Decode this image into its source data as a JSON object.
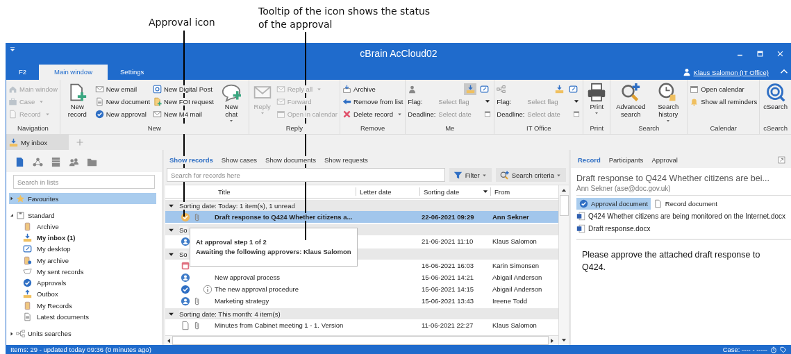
{
  "annotations": [
    {
      "text": "Approval icon"
    },
    {
      "text": "Tooltip of the icon shows the status of the approval"
    }
  ],
  "window": {
    "title": "cBrain AcCloud02"
  },
  "menu_tabs": [
    {
      "label": "F2",
      "selected": false
    },
    {
      "label": "Main window",
      "selected": true
    },
    {
      "label": "Settings",
      "selected": false
    }
  ],
  "user": "Klaus Salomon (IT Office)",
  "ribbon": [
    {
      "label": "Navigation",
      "items": [
        {
          "kind": "small",
          "label": "Main window",
          "disabled": true,
          "dropdown": false
        },
        {
          "kind": "small",
          "label": "Case",
          "disabled": true,
          "dropdown": true
        },
        {
          "kind": "small",
          "label": "Record",
          "disabled": true,
          "dropdown": true
        }
      ]
    },
    {
      "label": "New",
      "items": [
        {
          "kind": "large",
          "label": "New record",
          "disabled": false,
          "dropdown": false
        },
        {
          "kind": "small",
          "label": "New email",
          "disabled": false,
          "dropdown": false
        },
        {
          "kind": "small",
          "label": "New document",
          "disabled": false,
          "dropdown": false
        },
        {
          "kind": "small",
          "label": "New approval",
          "disabled": false,
          "dropdown": false
        },
        {
          "kind": "small",
          "label": "New Digital Post",
          "disabled": false,
          "dropdown": false
        },
        {
          "kind": "small",
          "label": "New FOI request",
          "disabled": false,
          "dropdown": false
        },
        {
          "kind": "small",
          "label": "New M4 mail",
          "disabled": false,
          "dropdown": false
        },
        {
          "kind": "large",
          "label": "New chat",
          "disabled": false,
          "dropdown": true
        }
      ]
    },
    {
      "label": "Reply",
      "items": [
        {
          "kind": "large",
          "label": "Reply",
          "disabled": true,
          "dropdown": true
        },
        {
          "kind": "small",
          "label": "Reply all",
          "disabled": true,
          "dropdown": true
        },
        {
          "kind": "small",
          "label": "Forward",
          "disabled": true,
          "dropdown": false
        },
        {
          "kind": "small",
          "label": "Open in calendar",
          "disabled": true,
          "dropdown": false
        }
      ]
    },
    {
      "label": "Remove",
      "items": [
        {
          "kind": "small",
          "label": "Archive",
          "disabled": false,
          "dropdown": false
        },
        {
          "kind": "small",
          "label": "Remove from list",
          "disabled": false,
          "dropdown": false
        },
        {
          "kind": "small",
          "label": "Delete record",
          "disabled": false,
          "dropdown": true
        }
      ]
    },
    {
      "label": "Me",
      "items": [
        {
          "kind": "icon_row",
          "toggles": [
            {
              "selected": true
            },
            {
              "selected": false
            }
          ]
        },
        {
          "kind": "dropdown_field",
          "label": "Flag:",
          "placeholder": "Select flag"
        },
        {
          "kind": "date_field",
          "label": "Deadline:",
          "placeholder": "Select date"
        }
      ]
    },
    {
      "label": "IT Office",
      "items": [
        {
          "kind": "icon_row",
          "toggles": [
            {
              "selected": false
            },
            {
              "selected": false
            }
          ]
        },
        {
          "kind": "dropdown_field",
          "label": "Flag:",
          "placeholder": "Select flag"
        },
        {
          "kind": "date_field",
          "label": "Deadline:",
          "placeholder": "Select date"
        }
      ]
    },
    {
      "label": "Print",
      "items": [
        {
          "kind": "large",
          "label": "Print",
          "disabled": false,
          "dropdown": true
        }
      ]
    },
    {
      "label": "Search",
      "items": [
        {
          "kind": "large",
          "label": "Advanced search",
          "disabled": false,
          "dropdown": false
        },
        {
          "kind": "large",
          "label": "Search history",
          "disabled": false,
          "dropdown": true
        }
      ]
    },
    {
      "label": "Calendar",
      "items": [
        {
          "kind": "small",
          "label": "Open calendar",
          "disabled": false,
          "dropdown": false
        },
        {
          "kind": "small",
          "label": "Show all reminders",
          "disabled": false,
          "dropdown": false
        }
      ]
    },
    {
      "label": "cSearch",
      "items": [
        {
          "kind": "large",
          "label": "cSearch",
          "disabled": false,
          "dropdown": false
        }
      ]
    }
  ],
  "doc_tabs": [
    {
      "label": "My inbox",
      "selected": true
    }
  ],
  "lists_toolbar": [
    {
      "selected": true
    },
    {
      "selected": false
    },
    {
      "selected": false
    },
    {
      "selected": false
    },
    {
      "selected": false
    }
  ],
  "lists_search": {
    "placeholder": "Search in lists"
  },
  "tree": [
    {
      "label": "Favourites",
      "expanded": false,
      "selected": true
    },
    {
      "label": "Standard",
      "expanded": true,
      "selected": false,
      "children": [
        {
          "label": "Archive",
          "unread": false,
          "selected": false
        },
        {
          "label": "My inbox (1)",
          "unread": true,
          "selected": false
        },
        {
          "label": "My desktop",
          "unread": false,
          "selected": false
        },
        {
          "label": "My archive",
          "unread": false,
          "selected": false
        },
        {
          "label": "My sent records",
          "unread": false,
          "selected": false
        },
        {
          "label": "Approvals",
          "unread": false,
          "selected": false
        },
        {
          "label": "Outbox",
          "unread": false,
          "selected": false
        },
        {
          "label": "My Records",
          "unread": false,
          "selected": false
        },
        {
          "label": "Latest documents",
          "unread": false,
          "selected": false
        }
      ]
    },
    {
      "label": "Units searches",
      "expanded": false,
      "selected": false
    }
  ],
  "view_tabs": [
    {
      "label": "Show records",
      "selected": true
    },
    {
      "label": "Show cases",
      "selected": false
    },
    {
      "label": "Show documents",
      "selected": false
    },
    {
      "label": "Show requests",
      "selected": false
    }
  ],
  "records_search": {
    "placeholder": "Search for records here"
  },
  "filter_button": "Filter",
  "criteria_button": "Search criteria",
  "columns": [
    {
      "label": "Title",
      "sorted": false
    },
    {
      "label": "Letter date",
      "sorted": false
    },
    {
      "label": "Sorting date",
      "sorted": true
    },
    {
      "label": "From",
      "sorted": false
    }
  ],
  "groups": [
    {
      "label": "Sorting date: Today: 1 item(s), 1 unread",
      "records": [
        {
          "kind": "approval_pending",
          "attachment": true,
          "title": "Draft response to Q424 Whether citizens a...",
          "sorting_date": "22-06-2021 09:29",
          "from": "Ann Sekner",
          "selected": true,
          "unread": true
        }
      ]
    },
    {
      "label": "So",
      "records": [
        {
          "kind": "approval_person",
          "sorting_date": "21-06-2021 11:10",
          "from": "Klaus Salomon",
          "selected": false,
          "unread": false
        }
      ]
    },
    {
      "label": "So",
      "records": [
        {
          "kind": "calendar",
          "sorting_date": "16-06-2021 16:03",
          "from": "Karin Simonsen",
          "selected": false,
          "unread": false
        },
        {
          "kind": "approval_person",
          "title": "New approval process",
          "sorting_date": "15-06-2021 14:21",
          "from": "Abigail Anderson",
          "selected": false,
          "unread": false
        },
        {
          "kind": "approval_done",
          "info": true,
          "title": "The new approval procedure",
          "sorting_date": "15-06-2021 14:15",
          "from": "Abigail Anderson",
          "selected": false,
          "unread": false
        },
        {
          "kind": "approval_person",
          "attachment": true,
          "title": "Marketing strategy",
          "sorting_date": "15-06-2021 13:43",
          "from": "Ireene Todd",
          "selected": false,
          "unread": false
        }
      ]
    },
    {
      "label": "Sorting date: This month: 4 item(s)",
      "records": [
        {
          "kind": "document",
          "attachment": true,
          "title": "Minutes from Cabinet meeting 1 - 1. Version",
          "sorting_date": "11-06-2021 22:27",
          "from": "Klaus Salomon",
          "selected": false,
          "unread": false
        }
      ]
    }
  ],
  "tooltip": {
    "lines": [
      "At approval step 1 of 2",
      "Awaiting the following approvers: Klaus Salomon"
    ]
  },
  "detail": {
    "tabs": [
      {
        "label": "Record",
        "selected": true
      },
      {
        "label": "Participants",
        "selected": false
      },
      {
        "label": "Approval",
        "selected": false
      }
    ],
    "title": "Draft response to Q424 Whether citizens are bei...",
    "sender": "Ann Sekner (ase@doc.gov.uk)",
    "doc_tabs": [
      {
        "label": "Approval document",
        "selected": true
      },
      {
        "label": "Record document",
        "selected": false
      }
    ],
    "attachments": [
      "Q424 Whether citizens are being monitored on the Internet.docx",
      "Draft response.docx"
    ],
    "body": "Please approve the attached draft response to Q424."
  },
  "status_bar": {
    "left": "Items: 29 - updated today 09:36 (0 minutes ago)",
    "right": "Case: ---- - -----"
  }
}
